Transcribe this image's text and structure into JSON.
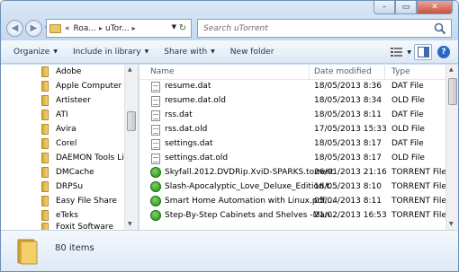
{
  "window": {
    "controls": {
      "minimize": "–",
      "maximize": "▭",
      "close": "✕"
    }
  },
  "address": {
    "overflow": "«",
    "crumbs": [
      "Roa...",
      "uTor..."
    ],
    "separator": "▸"
  },
  "search": {
    "placeholder": "Search uTorrent"
  },
  "toolbar": {
    "organize": "Organize",
    "include_in_library": "Include in library",
    "share_with": "Share with",
    "new_folder": "New folder"
  },
  "nav_items": [
    "Adobe",
    "Apple Computer",
    "Artisteer",
    "ATI",
    "Avira",
    "Corel",
    "DAEMON Tools Lite",
    "DMCache",
    "DRPSu",
    "Easy File Share",
    "eTeks",
    "Foxit Software"
  ],
  "columns": {
    "name": "Name",
    "date": "Date modified",
    "type": "Type"
  },
  "files": [
    {
      "name": "resume.dat",
      "date": "18/05/2013 8:36",
      "type": "DAT File",
      "icon": "document-icon"
    },
    {
      "name": "resume.dat.old",
      "date": "18/05/2013 8:34",
      "type": "OLD File",
      "icon": "document-icon"
    },
    {
      "name": "rss.dat",
      "date": "18/05/2013 8:11",
      "type": "DAT File",
      "icon": "document-icon"
    },
    {
      "name": "rss.dat.old",
      "date": "17/05/2013 15:33",
      "type": "OLD File",
      "icon": "document-icon"
    },
    {
      "name": "settings.dat",
      "date": "18/05/2013 8:17",
      "type": "DAT File",
      "icon": "document-icon"
    },
    {
      "name": "settings.dat.old",
      "date": "18/05/2013 8:17",
      "type": "OLD File",
      "icon": "document-icon"
    },
    {
      "name": "Skyfall.2012.DVDRip.XviD-SPARKS.torrent",
      "date": "26/01/2013 21:16",
      "type": "TORRENT File",
      "icon": "torrent-icon"
    },
    {
      "name": "Slash-Apocalyptic_Love_Deluxe_Edition.t...",
      "date": "18/05/2013 8:10",
      "type": "TORRENT File",
      "icon": "torrent-icon"
    },
    {
      "name": "Smart Home Automation with Linux.pdf....",
      "date": "05/04/2013 8:11",
      "type": "TORRENT File",
      "icon": "torrent-icon"
    },
    {
      "name": "Step-By-Step Cabinets and Shelves -Man...",
      "date": "21/02/2013 16:53",
      "type": "TORRENT File",
      "icon": "torrent-icon"
    }
  ],
  "status": {
    "items_count": "80 items"
  },
  "colors": {
    "accent": "#2b67c6",
    "folder": "#e9c762",
    "torrent": "#2b8a1d"
  }
}
